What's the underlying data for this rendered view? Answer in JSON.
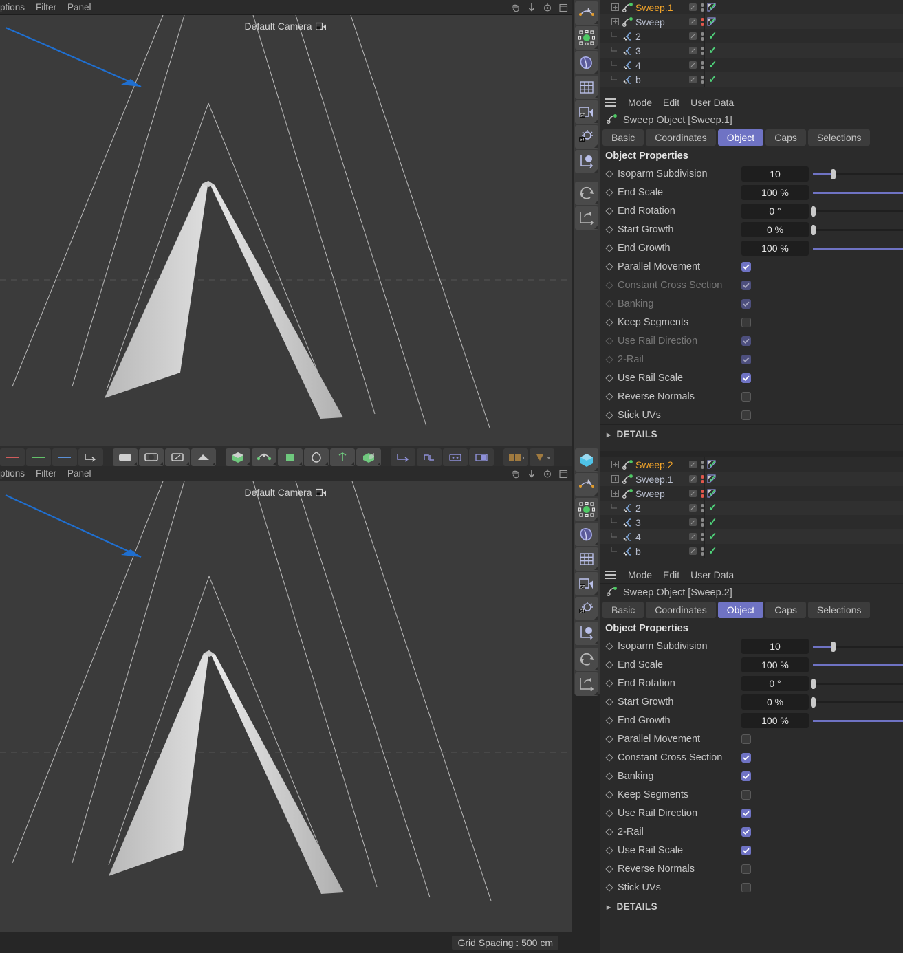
{
  "viewports": [
    {
      "menu_items": [
        "ptions",
        "Filter",
        "Panel"
      ],
      "camera_label": "Default Camera",
      "nav_icons": [
        "pan-hand-icon",
        "move-down-icon",
        "rotate-icon",
        "maximize-icon"
      ]
    },
    {
      "menu_items": [
        "ptions",
        "Filter",
        "Panel"
      ],
      "camera_label": "Default Camera",
      "nav_icons": [
        "pan-hand-icon",
        "move-down-icon",
        "rotate-icon",
        "maximize-icon"
      ]
    }
  ],
  "statusbar": {
    "grid_spacing": "Grid Spacing : 500 cm"
  },
  "icon_palette": [
    "spline-pen-icon",
    "null-object-icon",
    "deformer-icon",
    "array-grid-icon",
    "camera-icon",
    "light-icon",
    "axis-object-icon",
    "subdivision-surface-icon",
    "undo-arrow-icon"
  ],
  "icon_palette_lower": [
    "cube-object-icon",
    "spline-pen-icon",
    "null-object-icon",
    "deformer-icon",
    "array-grid-icon",
    "camera-icon",
    "light-icon",
    "axis-object-icon",
    "subdivision-surface-icon",
    "undo-arrow-icon"
  ],
  "object_managers": [
    {
      "rows": [
        {
          "name": "Sweep.1",
          "selected": true,
          "type": "sweep",
          "indent": 0,
          "expandable": true,
          "dots": "gray",
          "has_tag": true
        },
        {
          "name": "Sweep",
          "selected": false,
          "type": "sweep",
          "indent": 0,
          "expandable": true,
          "dots": "red",
          "has_tag": true
        },
        {
          "name": "2",
          "selected": false,
          "type": "spline",
          "indent": 1,
          "expandable": false,
          "dots": "gray",
          "has_tag": false
        },
        {
          "name": "3",
          "selected": false,
          "type": "spline",
          "indent": 1,
          "expandable": false,
          "dots": "gray",
          "has_tag": false
        },
        {
          "name": "4",
          "selected": false,
          "type": "spline",
          "indent": 1,
          "expandable": false,
          "dots": "gray",
          "has_tag": false
        },
        {
          "name": "b",
          "selected": false,
          "type": "spline",
          "indent": 1,
          "expandable": false,
          "dots": "gray",
          "has_tag": false
        }
      ]
    },
    {
      "rows": [
        {
          "name": "Sweep.2",
          "selected": true,
          "type": "sweep",
          "indent": 0,
          "expandable": true,
          "dots": "gray",
          "has_tag": true
        },
        {
          "name": "Sweep.1",
          "selected": false,
          "type": "sweep",
          "indent": 0,
          "expandable": true,
          "dots": "red",
          "has_tag": true
        },
        {
          "name": "Sweep",
          "selected": false,
          "type": "sweep",
          "indent": 0,
          "expandable": true,
          "dots": "red",
          "has_tag": true
        },
        {
          "name": "2",
          "selected": false,
          "type": "spline",
          "indent": 1,
          "expandable": false,
          "dots": "gray",
          "has_tag": false
        },
        {
          "name": "3",
          "selected": false,
          "type": "spline",
          "indent": 1,
          "expandable": false,
          "dots": "gray",
          "has_tag": false
        },
        {
          "name": "4",
          "selected": false,
          "type": "spline",
          "indent": 1,
          "expandable": false,
          "dots": "gray",
          "has_tag": false
        },
        {
          "name": "b",
          "selected": false,
          "type": "spline",
          "indent": 1,
          "expandable": false,
          "dots": "gray",
          "has_tag": false
        }
      ]
    }
  ],
  "attribute_managers": [
    {
      "menubar": [
        "Mode",
        "Edit",
        "User Data"
      ],
      "object_title": "Sweep Object [Sweep.1]",
      "tabs": [
        {
          "label": "Basic",
          "active": false
        },
        {
          "label": "Coordinates",
          "active": false
        },
        {
          "label": "Object",
          "active": true
        },
        {
          "label": "Caps",
          "active": false
        },
        {
          "label": "Selections",
          "active": false
        }
      ],
      "section_title": "Object Properties",
      "sliders": [
        {
          "label": "Isoparm Subdivision",
          "value": "10",
          "pct": 22,
          "dim": false
        },
        {
          "label": "End Scale",
          "value": "100 %",
          "pct": 100,
          "dim": false
        },
        {
          "label": "End Rotation",
          "value": "0 °",
          "pct": 0,
          "dim": false
        },
        {
          "label": "Start Growth",
          "value": "0 %",
          "pct": 0,
          "dim": false
        },
        {
          "label": "End Growth",
          "value": "100 %",
          "pct": 100,
          "dim": false
        }
      ],
      "checkboxes": [
        {
          "label": "Parallel Movement",
          "checked": true,
          "dim": false
        },
        {
          "label": "Constant Cross Section",
          "checked": true,
          "dim": true
        },
        {
          "label": "Banking",
          "checked": true,
          "dim": true
        },
        {
          "label": "Keep Segments",
          "checked": false,
          "dim": false
        },
        {
          "label": "Use Rail Direction",
          "checked": true,
          "dim": true
        },
        {
          "label": "2-Rail",
          "checked": true,
          "dim": true
        },
        {
          "label": "Use Rail Scale",
          "checked": true,
          "dim": false
        },
        {
          "label": "Reverse Normals",
          "checked": false,
          "dim": false
        },
        {
          "label": "Stick UVs",
          "checked": false,
          "dim": false
        }
      ],
      "details_label": "DETAILS"
    },
    {
      "menubar": [
        "Mode",
        "Edit",
        "User Data"
      ],
      "object_title": "Sweep Object [Sweep.2]",
      "tabs": [
        {
          "label": "Basic",
          "active": false
        },
        {
          "label": "Coordinates",
          "active": false
        },
        {
          "label": "Object",
          "active": true
        },
        {
          "label": "Caps",
          "active": false
        },
        {
          "label": "Selections",
          "active": false
        }
      ],
      "section_title": "Object Properties",
      "sliders": [
        {
          "label": "Isoparm Subdivision",
          "value": "10",
          "pct": 22,
          "dim": false
        },
        {
          "label": "End Scale",
          "value": "100 %",
          "pct": 100,
          "dim": false
        },
        {
          "label": "End Rotation",
          "value": "0 °",
          "pct": 0,
          "dim": false
        },
        {
          "label": "Start Growth",
          "value": "0 %",
          "pct": 0,
          "dim": false
        },
        {
          "label": "End Growth",
          "value": "100 %",
          "pct": 100,
          "dim": false
        }
      ],
      "checkboxes": [
        {
          "label": "Parallel Movement",
          "checked": false,
          "dim": false
        },
        {
          "label": "Constant Cross Section",
          "checked": true,
          "dim": false
        },
        {
          "label": "Banking",
          "checked": true,
          "dim": false
        },
        {
          "label": "Keep Segments",
          "checked": false,
          "dim": false
        },
        {
          "label": "Use Rail Direction",
          "checked": true,
          "dim": false
        },
        {
          "label": "2-Rail",
          "checked": true,
          "dim": false
        },
        {
          "label": "Use Rail Scale",
          "checked": true,
          "dim": false
        },
        {
          "label": "Reverse Normals",
          "checked": false,
          "dim": false
        },
        {
          "label": "Stick UVs",
          "checked": false,
          "dim": false
        }
      ],
      "details_label": "DETAILS"
    }
  ],
  "colors": {
    "accent": "#6f73c4",
    "selected_object": "#f0a32a",
    "tick_green": "#4fd17a",
    "dot_red": "#e2574c",
    "annotation_arrow": "#1f6fd0",
    "viewport_bg": "#3b3b3b",
    "panel_bg": "#2b2b2b"
  },
  "annotation": {
    "name": "blue-arrow-annotation"
  }
}
